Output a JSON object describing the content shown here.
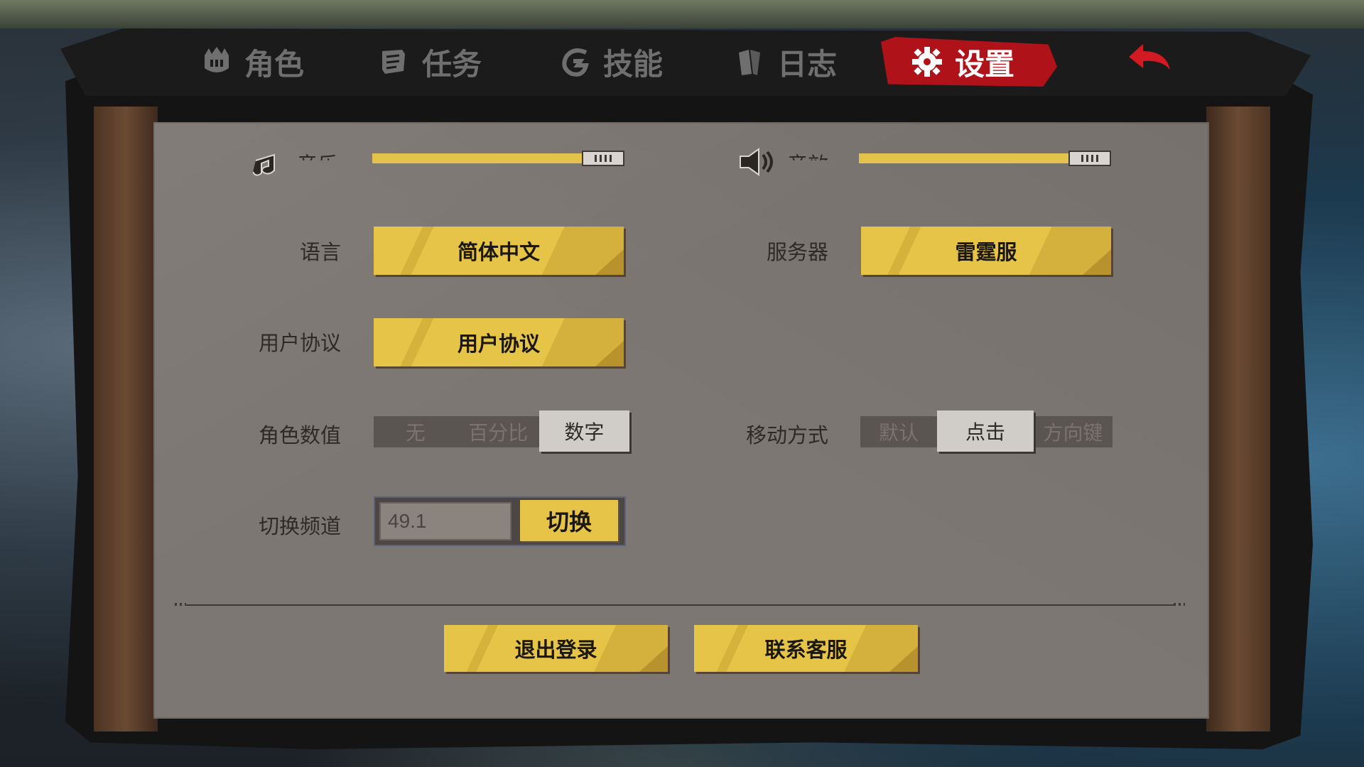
{
  "tabs": [
    {
      "label": "角色",
      "icon": "helmet-icon"
    },
    {
      "label": "任务",
      "icon": "scroll-icon"
    },
    {
      "label": "技能",
      "icon": "swirl-icon"
    },
    {
      "label": "日志",
      "icon": "book-icon"
    },
    {
      "label": "设置",
      "icon": "gear-icon",
      "active": true
    }
  ],
  "sliders": {
    "music": {
      "label": "音乐",
      "icon": "music-note-icon",
      "level": 0.86
    },
    "sfx": {
      "label": "音效",
      "icon": "speaker-icon",
      "level": 0.86
    }
  },
  "language": {
    "label": "语言",
    "value": "简体中文"
  },
  "server": {
    "label": "服务器",
    "value": "雷霆服"
  },
  "agreement": {
    "label": "用户协议",
    "button": "用户协议"
  },
  "stat_display": {
    "label": "角色数值",
    "options": [
      "无",
      "百分比",
      "数字"
    ],
    "selected": "数字"
  },
  "move_mode": {
    "label": "移动方式",
    "options": [
      "默认",
      "点击",
      "方向键"
    ],
    "selected": "点击"
  },
  "channel": {
    "label": "切换频道",
    "value": "49.1",
    "button": "切换"
  },
  "footer": {
    "logout": "退出登录",
    "support": "联系客服"
  },
  "colors": {
    "accent": "#e5c447",
    "active_tab": "#b0121a",
    "panel": "#7d7773"
  }
}
